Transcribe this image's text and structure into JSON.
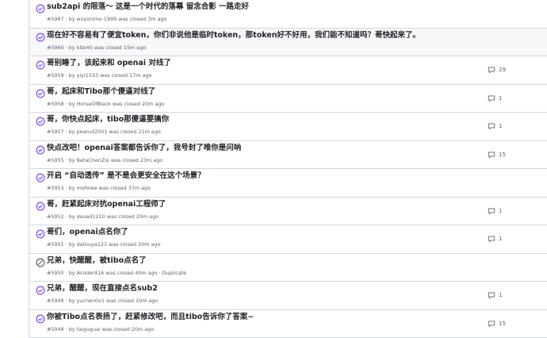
{
  "issues": [
    {
      "title": "sub2api 的限落～ 这是一个时代的落幕 留念合影 一路走好",
      "number": "#5967",
      "author": "wzyonline-1999",
      "closed": "3m ago",
      "suffix": "",
      "comments": "",
      "reason": "completed"
    },
    {
      "title": "现在好不容易有了便宜token，你们非说他是临时token，那token好不好用，我们能不知道吗？哥快起来了。",
      "number": "#5960",
      "author": "kite40",
      "closed": "15m ago",
      "suffix": "",
      "comments": "",
      "reason": "completed",
      "highlight": true
    },
    {
      "title": "哥别睡了，该起来和 openai 对线了",
      "number": "#5959",
      "author": "yiyi1333",
      "closed": "17m ago",
      "suffix": "",
      "comments": "29",
      "reason": "completed"
    },
    {
      "title": "哥，起床和Tibo那个傻逼对线了",
      "number": "#5958",
      "author": "HorseOfBlack",
      "closed": "20m ago",
      "suffix": "",
      "comments": "1",
      "reason": "completed"
    },
    {
      "title": "哥，你快点起床，tibo那傻逼要搞你",
      "number": "#5957",
      "author": "peanut2001",
      "closed": "21m ago",
      "suffix": "",
      "comments": "1",
      "reason": "completed"
    },
    {
      "title": "快点改吧！openai答案都告诉你了，我号封了唯你是问呐",
      "number": "#5955",
      "author": "BetaChenZix",
      "closed": "23m ago",
      "suffix": "",
      "comments": "15",
      "reason": "completed"
    },
    {
      "title": "开启 “自动透传” 是不是会更安全在这个场景？",
      "number": "#5953",
      "author": "mofelee",
      "closed": "37m ago",
      "suffix": "",
      "comments": "",
      "reason": "completed"
    },
    {
      "title": "哥，赶紧起床对抗openai工程师了",
      "number": "#5952",
      "author": "daved1210",
      "closed": "20m ago",
      "suffix": "",
      "comments": "1",
      "reason": "completed"
    },
    {
      "title": "哥们，openai点名你了",
      "number": "#5951",
      "author": "datouya123",
      "closed": "20m ago",
      "suffix": "",
      "comments": "1",
      "reason": "completed"
    },
    {
      "title": "兄弟，快醒醒，被tibo点名了",
      "number": "#5950",
      "author": "Acoder416",
      "closed": "40m ago",
      "suffix": " · Duplicate",
      "comments": "",
      "reason": "duplicate"
    },
    {
      "title": "兄弟，醒醒，现在直接点名sub2",
      "number": "#5949",
      "author": "yuchen0x1",
      "closed": "20m ago",
      "suffix": "",
      "comments": "1",
      "reason": "completed"
    },
    {
      "title": "你被Tibo点名表扬了，赶紧修改吧，而且tibo告诉你了答案~",
      "number": "#5948",
      "author": "taiguguai",
      "closed": "20m ago",
      "suffix": "",
      "comments": "15",
      "reason": "completed"
    }
  ],
  "meta_by": "by",
  "meta_closed": "was closed",
  "colors": {
    "closed_completed": "#8250df",
    "closed_duplicate": "#59636e"
  }
}
